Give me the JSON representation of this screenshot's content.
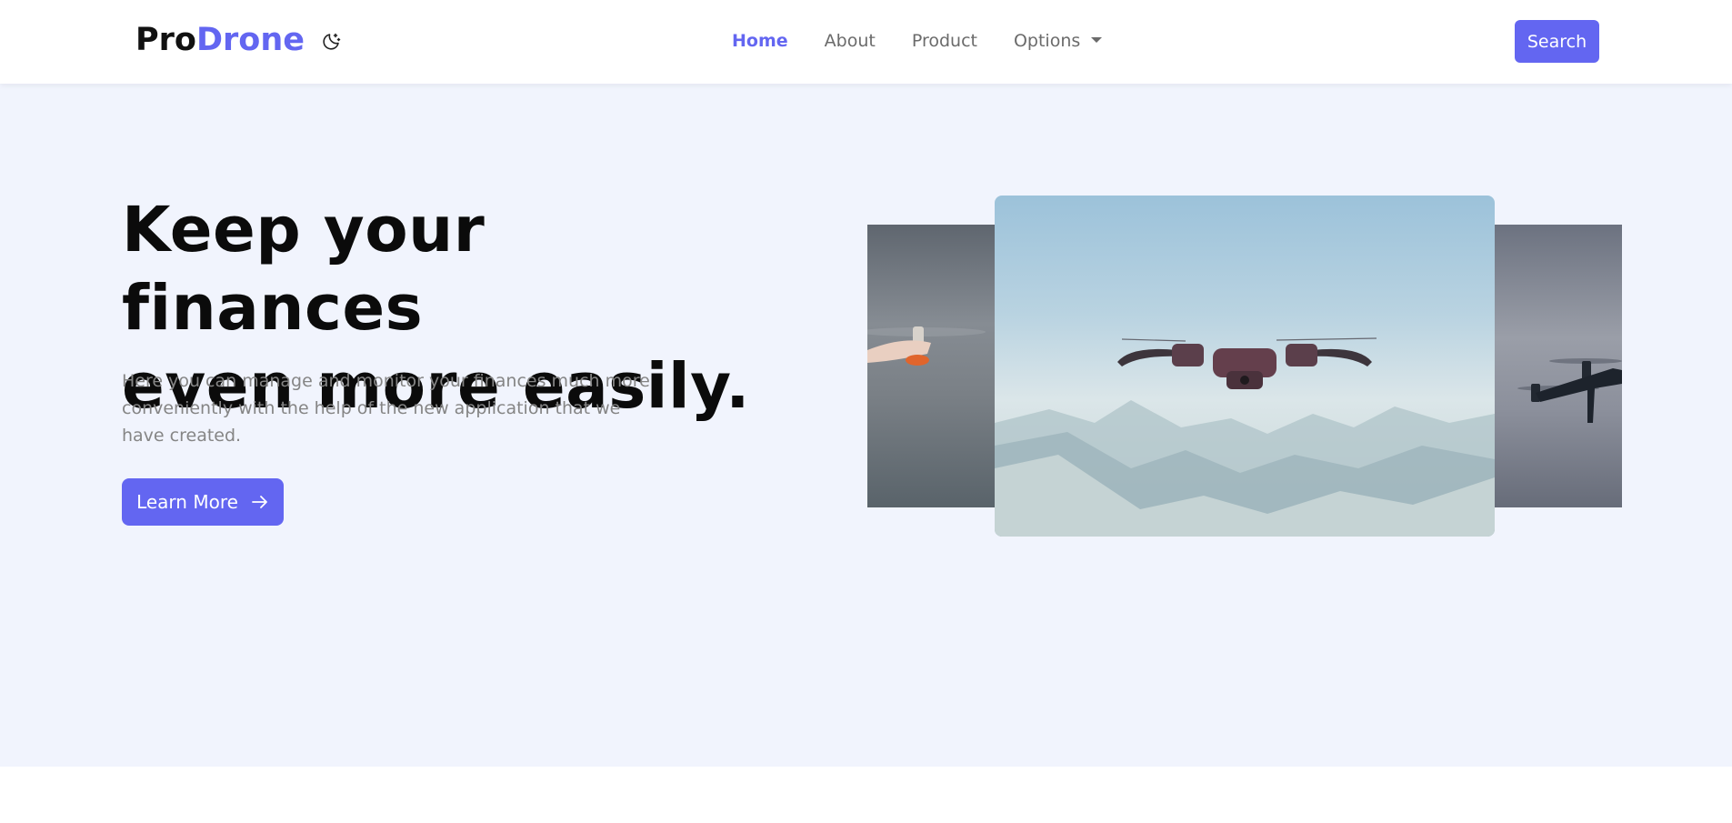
{
  "brand": {
    "part1": "Pro",
    "part2": "Drone"
  },
  "nav": {
    "home": "Home",
    "about": "About",
    "product": "Product",
    "options": "Options"
  },
  "search_label": "Search",
  "hero": {
    "title_line1": "Keep your finances",
    "title_line2": "even more easily.",
    "text": "Here you can manage and monitor your finances much more conveniently with the help of the new application that we have created.",
    "cta_label": "Learn More"
  },
  "icons": {
    "theme": "moon-stars-icon",
    "cta": "arrow-right-icon",
    "options": "caret-down-icon"
  },
  "colors": {
    "accent": "#6366f1",
    "hero_background": "#f1f4fd"
  }
}
